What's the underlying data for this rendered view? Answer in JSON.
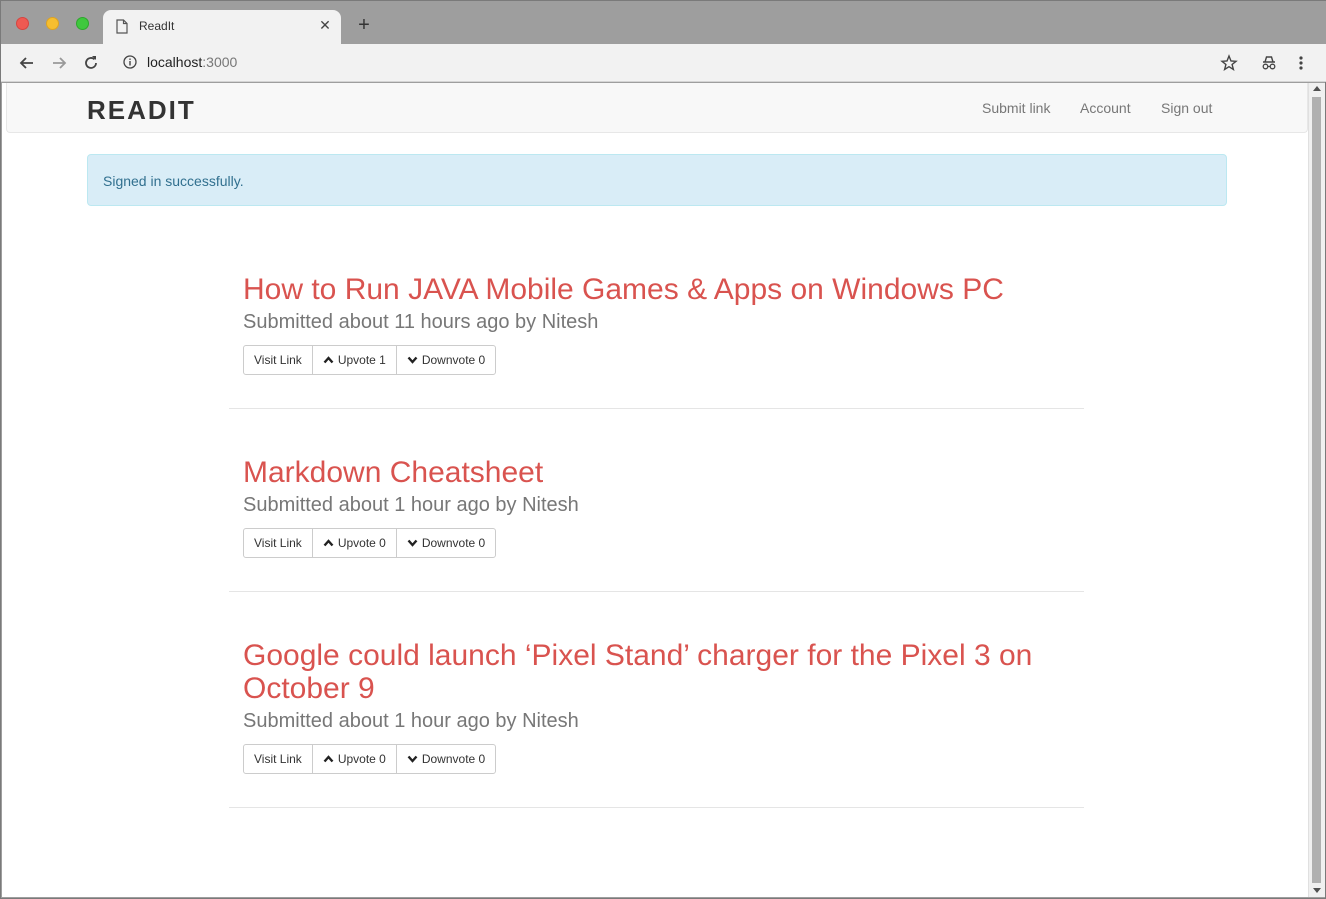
{
  "browser": {
    "tab_title": "ReadIt",
    "url_host": "localhost",
    "url_port": ":3000"
  },
  "navbar": {
    "brand": "READIT",
    "links": [
      "Submit link",
      "Account",
      "Sign out"
    ]
  },
  "alert": {
    "message": "Signed in successfully."
  },
  "posts": [
    {
      "title": "How to Run JAVA Mobile Games & Apps on Windows PC",
      "meta": "Submitted about 11 hours ago by Nitesh",
      "visit_label": "Visit Link",
      "upvote_label": "Upvote 1",
      "downvote_label": "Downvote 0"
    },
    {
      "title": "Markdown Cheatsheet",
      "meta": "Submitted about 1 hour ago by Nitesh",
      "visit_label": "Visit Link",
      "upvote_label": "Upvote 0",
      "downvote_label": "Downvote 0"
    },
    {
      "title": "Google could launch ‘Pixel Stand’ charger for the Pixel 3 on October 9",
      "meta": "Submitted about 1 hour ago by Nitesh",
      "visit_label": "Visit Link",
      "upvote_label": "Upvote 0",
      "downvote_label": "Downvote 0"
    }
  ],
  "colors": {
    "post_title": "#d9534f",
    "alert_bg": "#d9edf7",
    "alert_text": "#31708f"
  }
}
